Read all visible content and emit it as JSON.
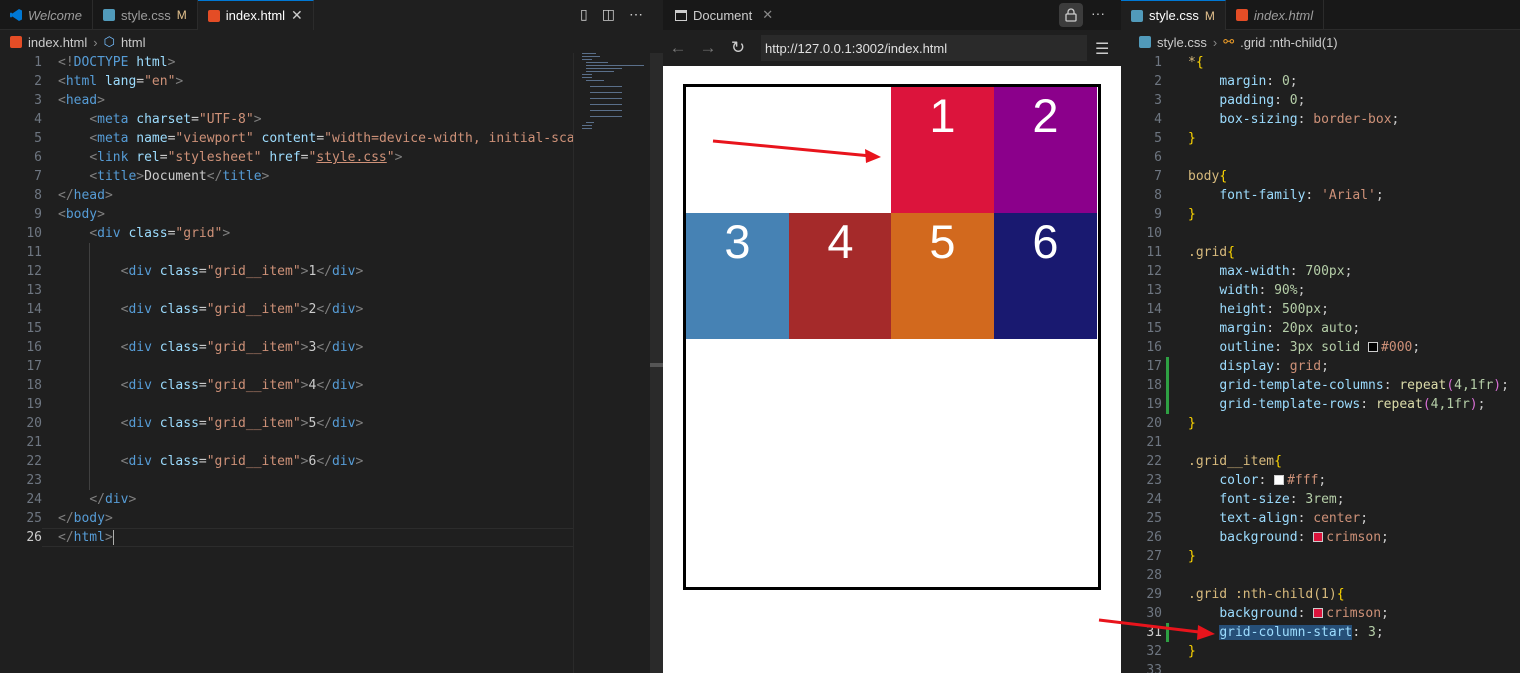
{
  "left_editor": {
    "tabs": [
      {
        "label": "Welcome",
        "icon": "vscode-icon",
        "active": false
      },
      {
        "label": "style.css",
        "modified": "M",
        "icon": "css-file-icon",
        "active": false
      },
      {
        "label": "index.html",
        "close": "✕",
        "icon": "html-file-icon",
        "active": true
      }
    ],
    "breadcrumb": {
      "file": "index.html",
      "symbol": "html"
    },
    "line_numbers": [
      "1",
      "2",
      "3",
      "4",
      "5",
      "6",
      "7",
      "8",
      "9",
      "10",
      "11",
      "12",
      "13",
      "14",
      "15",
      "16",
      "17",
      "18",
      "19",
      "20",
      "21",
      "22",
      "23",
      "24",
      "25",
      "26"
    ],
    "code": {
      "l1": {
        "a": "<!",
        "b": "DOCTYPE",
        "c": " html",
        "d": ">"
      },
      "l2": {
        "a": "<",
        "b": "html",
        "c": " lang",
        "d": "=",
        "e": "\"en\"",
        "f": ">"
      },
      "l3": {
        "a": "<",
        "b": "head",
        "c": ">"
      },
      "l4": {
        "a": "<",
        "b": "meta",
        "c": " charset",
        "d": "=",
        "e": "\"UTF-8\"",
        "f": ">"
      },
      "l5": {
        "a": "<",
        "b": "meta",
        "c": " name",
        "d": "=",
        "e": "\"viewport\"",
        "f": " content",
        "g": "=",
        "h": "\"width=device-width, initial-scal"
      },
      "l6": {
        "a": "<",
        "b": "link",
        "c": " rel",
        "d": "=",
        "e": "\"stylesheet\"",
        "f": " href",
        "g": "=",
        "h": "\"",
        "i": "style.css",
        "j": "\"",
        "k": ">"
      },
      "l7": {
        "a": "<",
        "b": "title",
        "c": ">",
        "d": "Document",
        "e": "</",
        "f": "title",
        "g": ">"
      },
      "l8": {
        "a": "</",
        "b": "head",
        "c": ">"
      },
      "l9": {
        "a": "<",
        "b": "body",
        "c": ">"
      },
      "l10": {
        "a": "<",
        "b": "div",
        "c": " class",
        "d": "=",
        "e": "\"grid\"",
        "f": ">"
      },
      "l12": {
        "a": "<",
        "b": "div",
        "c": " class",
        "d": "=",
        "e": "\"grid__item\"",
        "f": ">",
        "g": "1",
        "h": "</",
        "i": "div",
        "j": ">"
      },
      "l14": {
        "a": "<",
        "b": "div",
        "c": " class",
        "d": "=",
        "e": "\"grid__item\"",
        "f": ">",
        "g": "2",
        "h": "</",
        "i": "div",
        "j": ">"
      },
      "l16": {
        "a": "<",
        "b": "div",
        "c": " class",
        "d": "=",
        "e": "\"grid__item\"",
        "f": ">",
        "g": "3",
        "h": "</",
        "i": "div",
        "j": ">"
      },
      "l18": {
        "a": "<",
        "b": "div",
        "c": " class",
        "d": "=",
        "e": "\"grid__item\"",
        "f": ">",
        "g": "4",
        "h": "</",
        "i": "div",
        "j": ">"
      },
      "l20": {
        "a": "<",
        "b": "div",
        "c": " class",
        "d": "=",
        "e": "\"grid__item\"",
        "f": ">",
        "g": "5",
        "h": "</",
        "i": "div",
        "j": ">"
      },
      "l22": {
        "a": "<",
        "b": "div",
        "c": " class",
        "d": "=",
        "e": "\"grid__item\"",
        "f": ">",
        "g": "6",
        "h": "</",
        "i": "div",
        "j": ">"
      },
      "l24": {
        "a": "</",
        "b": "div",
        "c": ">"
      },
      "l25": {
        "a": "</",
        "b": "body",
        "c": ">"
      },
      "l26": {
        "a": "</",
        "b": "html",
        "c": ">"
      }
    }
  },
  "browser": {
    "tab_title": "Document",
    "tab_close": "✕",
    "more": "···",
    "url": "http://127.0.0.1:3002/index.html",
    "grid_items": [
      {
        "label": "1",
        "color": "#dc143c"
      },
      {
        "label": "2",
        "color": "#8b008b"
      },
      {
        "label": "3",
        "color": "#4682b4"
      },
      {
        "label": "4",
        "color": "#a52a2a"
      },
      {
        "label": "5",
        "color": "#d2691e"
      },
      {
        "label": "6",
        "color": "#191970"
      }
    ]
  },
  "right_editor": {
    "tabs": [
      {
        "label": "style.css",
        "modified": "M",
        "icon": "css-file-icon",
        "active": true
      },
      {
        "label": "index.html",
        "icon": "html-file-icon",
        "active": false
      }
    ],
    "breadcrumb": {
      "file": "style.css",
      "symbol": ".grid :nth-child(1)"
    },
    "line_numbers": [
      "1",
      "2",
      "3",
      "4",
      "5",
      "6",
      "7",
      "8",
      "9",
      "10",
      "11",
      "12",
      "13",
      "14",
      "15",
      "16",
      "17",
      "18",
      "19",
      "20",
      "21",
      "22",
      "23",
      "24",
      "25",
      "26",
      "27",
      "28",
      "29",
      "30",
      "31",
      "32",
      "33"
    ],
    "css": {
      "l1": {
        "a": "*",
        "b": "{"
      },
      "l2": {
        "p": "margin",
        "v": "0"
      },
      "l3": {
        "p": "padding",
        "v": "0"
      },
      "l4": {
        "p": "box-sizing",
        "v": "border-box"
      },
      "close": "}",
      "l7": {
        "a": "body",
        "b": "{"
      },
      "l8": {
        "p": "font-family",
        "v": "'Arial'"
      },
      "l11": {
        "a": ".grid",
        "b": "{"
      },
      "l12": {
        "p": "max-width",
        "v": "700px"
      },
      "l13": {
        "p": "width",
        "v": "90%"
      },
      "l14": {
        "p": "height",
        "v": "500px"
      },
      "l15": {
        "p": "margin",
        "v": "20px auto"
      },
      "l16": {
        "p": "outline",
        "v": "3px solid ",
        "c": "#000"
      },
      "l17": {
        "p": "display",
        "v": "grid"
      },
      "l18": {
        "p": "grid-template-columns",
        "fn": "repeat",
        "arg": "4,1fr"
      },
      "l19": {
        "p": "grid-template-rows",
        "fn": "repeat",
        "arg": "4,1fr"
      },
      "l22": {
        "a": ".grid__item",
        "b": "{"
      },
      "l23": {
        "p": "color",
        "c": "#fff"
      },
      "l24": {
        "p": "font-size",
        "v": "3rem"
      },
      "l25": {
        "p": "text-align",
        "v": "center"
      },
      "l26": {
        "p": "background",
        "c": "crimson"
      },
      "l29": {
        "a": ".grid :nth-child(1)",
        "b": "{"
      },
      "l30": {
        "p": "background",
        "c": "crimson"
      },
      "l31": {
        "p": "grid-column-start",
        "v": "3"
      }
    },
    "colors": {
      "swatch_black": "#000000",
      "swatch_white": "#ffffff",
      "swatch_crimson": "#dc143c"
    }
  },
  "annotations": {
    "arrow_color": "#e8141c"
  }
}
